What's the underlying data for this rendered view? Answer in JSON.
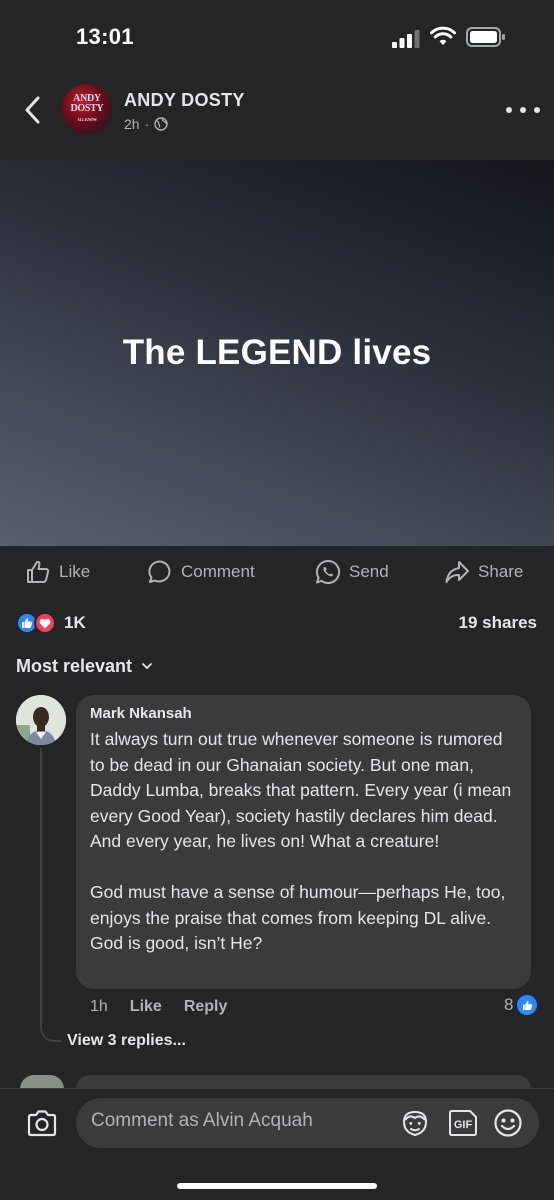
{
  "status_bar": {
    "time": "13:01"
  },
  "post": {
    "page_name": "ANDY DOSTY",
    "time_ago": "2h",
    "separator": "·",
    "avatar_logo": "ANDY DOSTY",
    "avatar_logo_sub": "ALL KNOW",
    "text": "The LEGEND lives"
  },
  "actions": {
    "like": "Like",
    "comment": "Comment",
    "send": "Send",
    "share": "Share"
  },
  "stats": {
    "reactions": "1K",
    "shares": "19 shares"
  },
  "sort": {
    "label": "Most relevant"
  },
  "comment": {
    "author": "Mark Nkansah",
    "body": "It always turn out true whenever someone is rumored to be dead in our Ghanaian society. But one man, Daddy Lumba, breaks that pattern. Every year (i mean every Good Year), society hastily declares him dead. And every year, he lives on! What a creature!\n\nGod must have a sense of humour—perhaps He, too, enjoys the praise that comes from keeping DL alive. God is good, isn’t He?",
    "time": "1h",
    "like_label": "Like",
    "reply_label": "Reply",
    "likes": "8",
    "view_replies": "View 3 replies..."
  },
  "composer": {
    "placeholder": "Comment as Alvin Acquah",
    "gif_label": "GIF"
  },
  "colors": {
    "accent": "#2d88ff",
    "love": "#f33e58",
    "background": "#242526",
    "bubble": "#3a3b3c"
  }
}
